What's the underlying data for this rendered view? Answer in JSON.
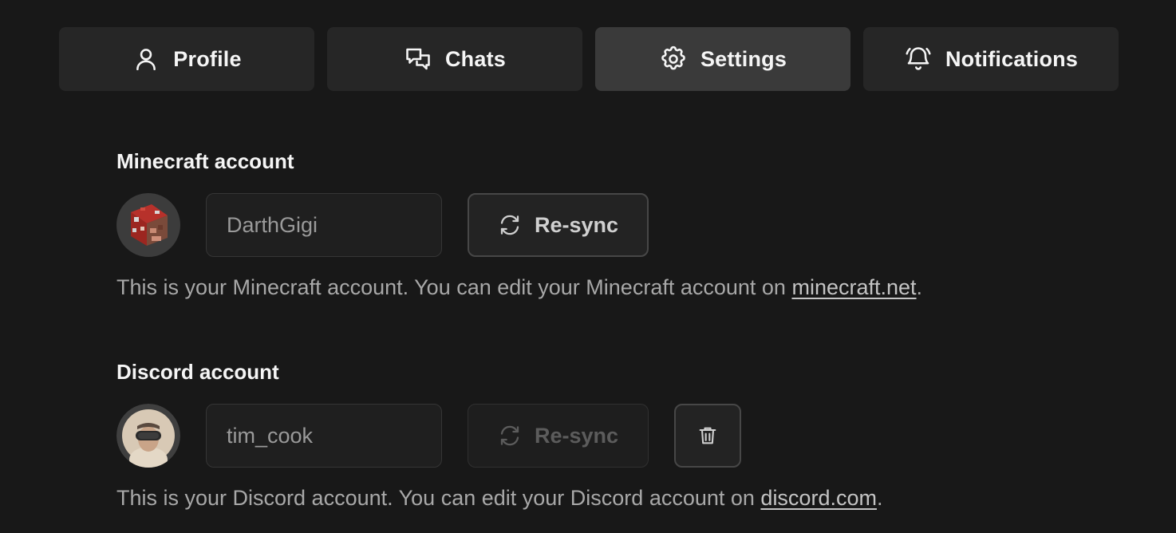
{
  "tabs": [
    {
      "label": "Profile",
      "icon": "user-icon",
      "active": false
    },
    {
      "label": "Chats",
      "icon": "chat-bubbles-icon",
      "active": false
    },
    {
      "label": "Settings",
      "icon": "gear-icon",
      "active": true
    },
    {
      "label": "Notifications",
      "icon": "bell-icon",
      "active": false
    }
  ],
  "minecraft": {
    "title": "Minecraft account",
    "username": "DarthGigi",
    "resync_label": "Re-sync",
    "description": "This is your Minecraft account. You can edit your Minecraft account on ",
    "link_text": "minecraft.net",
    "suffix": "."
  },
  "discord": {
    "title": "Discord account",
    "username": "tim_cook",
    "resync_label": "Re-sync",
    "description": "This is your Discord account. You can edit your Discord account on ",
    "link_text": "discord.com",
    "suffix": "."
  },
  "colors": {
    "background": "#181818",
    "tab": "#262626",
    "tab_active": "#3a3a3a",
    "text": "#f5f5f5",
    "muted": "#a8a8a8"
  }
}
